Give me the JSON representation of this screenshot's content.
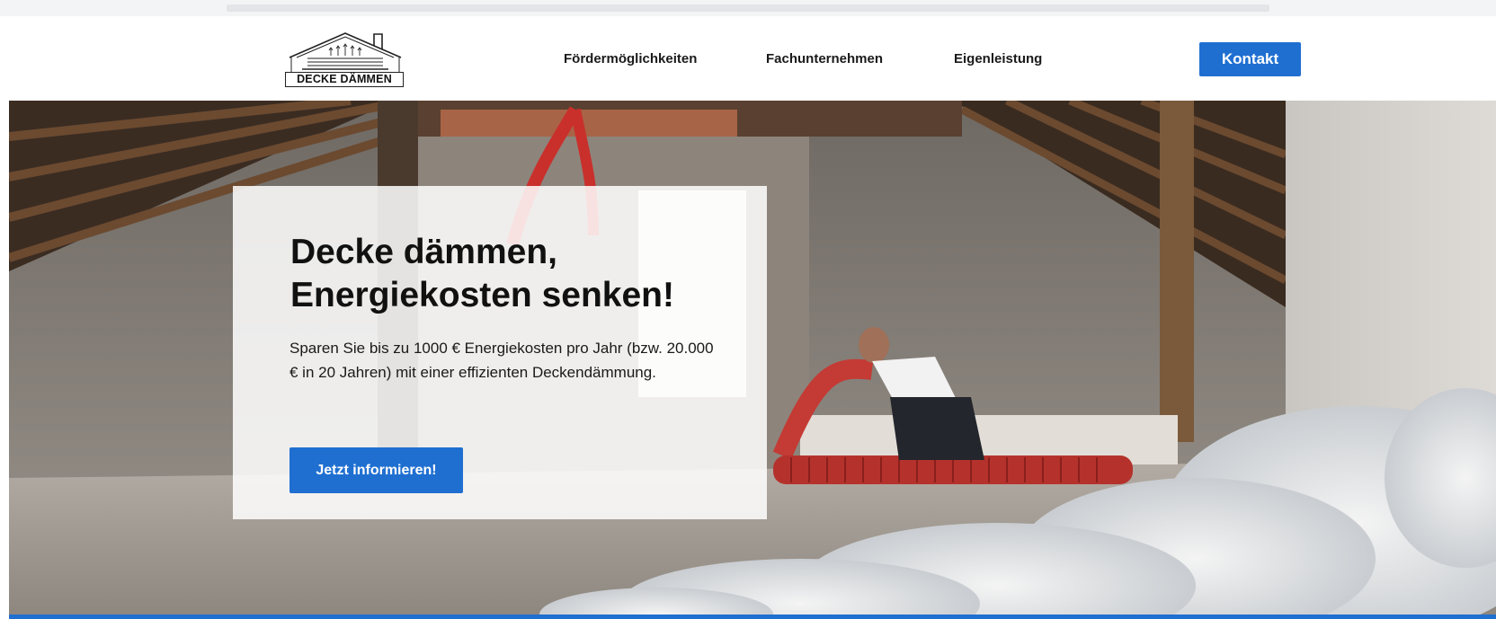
{
  "header": {
    "logo_text": "DECKE DÄMMEN",
    "nav": [
      {
        "label": "Fördermöglichkeiten"
      },
      {
        "label": "Fachunternehmen"
      },
      {
        "label": "Eigenleistung"
      }
    ],
    "contact_button": "Kontakt"
  },
  "hero": {
    "title_line1": "Decke dämmen,",
    "title_line2": "Energiekosten senken!",
    "text": "Sparen Sie bis zu 1000 € Energiekosten pro Jahr (bzw. 20.000 € in 20 Jahren) mit einer effizienten Deckendämmung.",
    "button": "Jetzt informieren!"
  },
  "colors": {
    "accent": "#1f6fd1",
    "card_bg": "#ffffff",
    "text": "#111111"
  },
  "icons": {
    "logo": "house-roof-logo-icon"
  }
}
